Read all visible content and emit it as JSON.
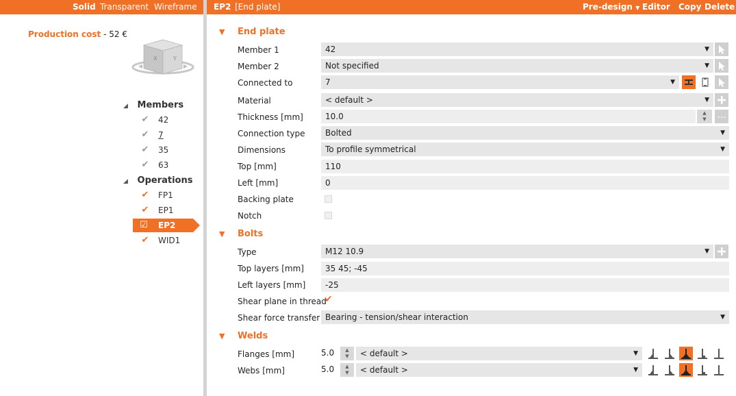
{
  "view_modes": {
    "solid": "Solid",
    "transparent": "Transparent",
    "wireframe": "Wireframe"
  },
  "production_cost": {
    "label": "Production cost",
    "separator": "-",
    "value": "52 €"
  },
  "tree": {
    "members_label": "Members",
    "members": [
      "42",
      "7",
      "35",
      "63"
    ],
    "operations_label": "Operations",
    "operations": [
      "FP1",
      "EP1",
      "EP2",
      "WID1"
    ],
    "selected_operation": "EP2"
  },
  "header": {
    "operation_name": "EP2",
    "operation_type": "[End plate]",
    "predesign": "Pre-design",
    "editor": "Editor",
    "copy": "Copy",
    "delete": "Delete"
  },
  "end_plate": {
    "section_title": "End plate",
    "member1_label": "Member 1",
    "member1_value": "42",
    "member2_label": "Member 2",
    "member2_value": "Not specified",
    "connected_to_label": "Connected to",
    "connected_to_value": "7",
    "material_label": "Material",
    "material_value": "< default >",
    "thickness_label": "Thickness [mm]",
    "thickness_value": "10.0",
    "connection_type_label": "Connection type",
    "connection_type_value": "Bolted",
    "dimensions_label": "Dimensions",
    "dimensions_value": "To profile symmetrical",
    "top_label": "Top [mm]",
    "top_value": "110",
    "left_label": "Left [mm]",
    "left_value": "0",
    "backing_plate_label": "Backing plate",
    "notch_label": "Notch",
    "more_button": "..."
  },
  "bolts": {
    "section_title": "Bolts",
    "type_label": "Type",
    "type_value": "M12 10.9",
    "top_layers_label": "Top layers [mm]",
    "top_layers_value": "35 45; -45",
    "left_layers_label": "Left layers [mm]",
    "left_layers_value": "-25",
    "shear_plane_label": "Shear plane in thread",
    "shear_force_label": "Shear force transfer",
    "shear_force_value": "Bearing - tension/shear interaction"
  },
  "welds": {
    "section_title": "Welds",
    "flanges_label": "Flanges [mm]",
    "flanges_size": "5.0",
    "flanges_material": "< default >",
    "webs_label": "Webs [mm]",
    "webs_size": "5.0",
    "webs_material": "< default >"
  },
  "colors": {
    "accent": "#f07025",
    "field_bg": "#e6e6e6",
    "divider": "#d3d3d3"
  }
}
